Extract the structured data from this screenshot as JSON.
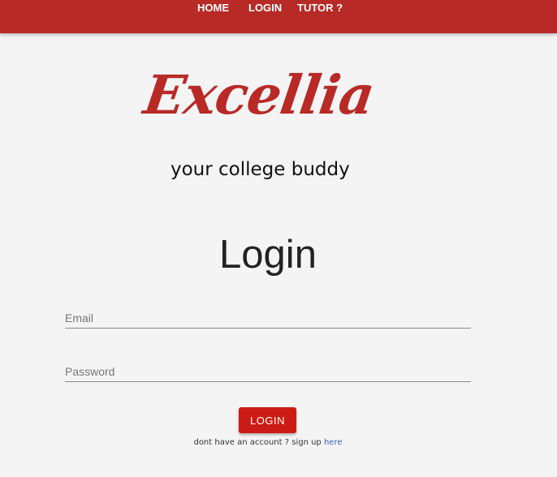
{
  "nav": {
    "items": [
      {
        "label": "HOME"
      },
      {
        "label": "LOGIN"
      },
      {
        "label": "TUTOR ?"
      }
    ]
  },
  "brand": {
    "logo_text": "Excellia",
    "tagline": "your college buddy"
  },
  "login": {
    "title": "Login",
    "email_placeholder": "Email",
    "password_placeholder": "Password",
    "submit_label": "LOGIN",
    "signup_prompt": "dont have an account ? sign up",
    "signup_link": "here"
  },
  "colors": {
    "brand_red": "#b82a26",
    "button_red": "#cc1a14",
    "link_blue": "#3366bb"
  }
}
